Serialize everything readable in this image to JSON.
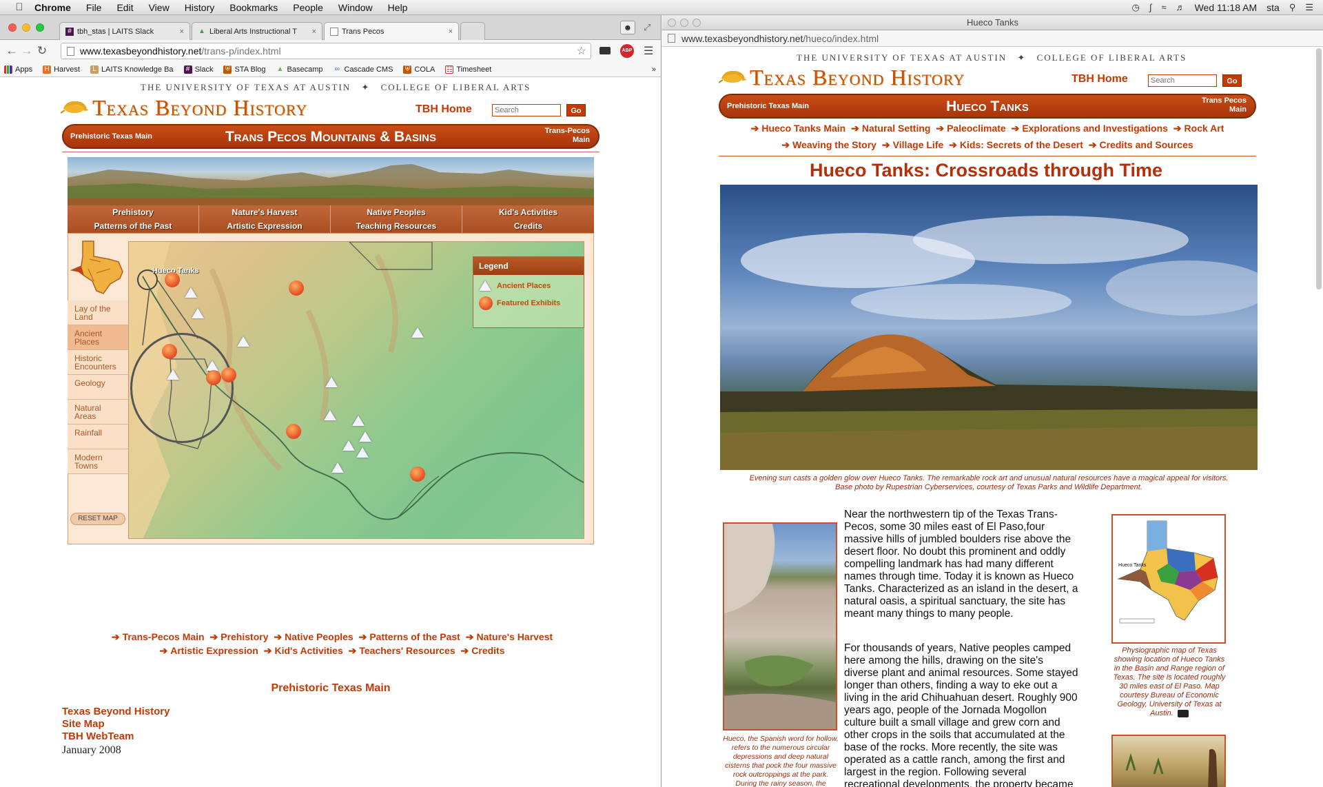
{
  "menubar": {
    "app": "Chrome",
    "items": [
      "File",
      "Edit",
      "View",
      "History",
      "Bookmarks",
      "People",
      "Window",
      "Help"
    ],
    "clock": "Wed 11:18 AM",
    "user": "sta"
  },
  "left_window": {
    "tabs": [
      {
        "label": "tbh_stas | LAITS Slack"
      },
      {
        "label": "Liberal Arts Instructional T"
      },
      {
        "label": "Trans Pecos"
      }
    ],
    "url_host": "www.texasbeyondhistory.net",
    "url_path": "/trans-p/index.html",
    "bookmarks": [
      "Apps",
      "Harvest",
      "LAITS Knowledge Ba",
      "Slack",
      "STA Blog",
      "Basecamp",
      "Cascade CMS",
      "COLA",
      "Timesheet"
    ],
    "bookmarks_more": "»"
  },
  "tbh": {
    "university": "THE UNIVERSITY OF TEXAS AT AUSTIN",
    "separator": "✦",
    "college": "COLLEGE OF LIBERAL ARTS",
    "logo": "Texas Beyond History",
    "home": "TBH Home",
    "search_placeholder": "Search",
    "go": "Go"
  },
  "left_page": {
    "bar_left": "Prehistoric Texas Main",
    "bar_title": "Trans Pecos Mountains & Basins",
    "bar_right_1": "Trans-Pecos",
    "bar_right_2": "Main",
    "nav": [
      "Prehistory",
      "Nature's Harvest",
      "Native Peoples",
      "Kid's Activities",
      "Patterns of the Past",
      "Artistic Expression",
      "Teaching Resources",
      "Credits"
    ],
    "sidenav": [
      "Lay of the Land",
      "Ancient Places",
      "Historic Encounters",
      "Geology",
      "Natural Areas",
      "Rainfall",
      "Modern Towns"
    ],
    "reset": "RESET MAP",
    "map_label": "Hueco Tanks",
    "legend_title": "Legend",
    "legend_items": [
      "Ancient Places",
      "Featured Exhibits"
    ],
    "links1": [
      "Trans-Pecos Main",
      "Prehistory",
      "Native Peoples",
      "Patterns of the Past",
      "Nature's Harvest"
    ],
    "links2": [
      "Artistic Expression",
      "Kid's Activities",
      "Teachers' Resources",
      "Credits"
    ],
    "prehistoric_main": "Prehistoric Texas Main",
    "footer_links": [
      "Texas Beyond History",
      "Site Map",
      "TBH WebTeam"
    ],
    "date": "January 2008"
  },
  "right_window": {
    "title": "Hueco Tanks",
    "url_host": "www.texasbeyondhistory.net",
    "url_path": "/hueco/index.html",
    "bar_left": "Prehistoric Texas Main",
    "bar_title": "Hueco Tanks",
    "bar_right_1": "Trans Pecos",
    "bar_right_2": "Main",
    "links1": [
      "Hueco Tanks Main",
      "Natural Setting",
      "Paleoclimate",
      "Explorations and Investigations",
      "Rock Art"
    ],
    "links2": [
      "Weaving the Story",
      "Village Life",
      "Kids: Secrets of the Desert",
      "Credits and Sources"
    ],
    "heading": "Hueco Tanks: Crossroads through Time",
    "hero_caption_1": "Evening sun casts a golden glow over Hueco Tanks. The remarkable rock art and unusual natural resources have a magical appeal for visitors.",
    "hero_caption_2": "Base photo by Rupestrian Cyberservices, courtesy of Texas Parks and Wildlife Department.",
    "para1": "Near the northwestern tip of the Texas Trans-Pecos, some 30 miles east of El Paso,four massive hills of jumbled boulders rise above the desert floor. No doubt this prominent and oddly compelling landmark has had many different names through time. Today it is known as Hueco Tanks. Characterized as an island in the desert, a natural oasis, a spiritual sanctuary, the site has meant many things to many people.",
    "para2": "For thousands of years, Native peoples camped here among the hills, drawing on the site's diverse plant and animal resources. Some stayed longer than others, finding a way to eke out a living in the arid Chihuahuan desert. Roughly 900 years ago, people of the Jornada Mogollon culture built a small village and grew corn and other crops in the soils that accumulated at the base of the rocks. More recently, the site was operated as a cattle ranch, among the first and largest in the region. Following several recreational developments, the property became a county park, and finally",
    "left_caption": "Hueco, the Spanish word for hollow, refers to the numerous circular depressions and deep natural cisterns that pock the four massive rock outcroppings at the park. During the rainy season, the huecos hold rainwater, attracting a variety of",
    "map_caption": "Physiographic map of Texas showing location of Hueco Tanks in the Basin and Range region of Texas. The site is located roughly 30 miles east of El Paso. Map courtesy Bureau of Economic Geology, University of Texas at Austin.",
    "map_inset_label": "Hueco Tanks"
  },
  "colors": {
    "brand_red": "#c13a05",
    "bar_red": "#a8340a"
  }
}
